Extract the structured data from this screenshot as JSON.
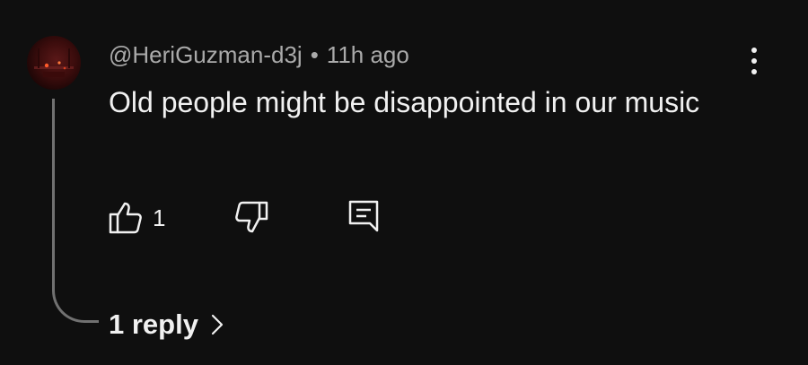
{
  "comment": {
    "author": "@HeriGuzman-d3j",
    "separator": "•",
    "timestamp": "11h ago",
    "text": "Old people might be disappointed in our music",
    "like_count": "1"
  },
  "replies": {
    "label": "1 reply"
  },
  "icons": {
    "avatar": "avatar-image",
    "more": "more-vertical-icon",
    "like": "thumbs-up-icon",
    "dislike": "thumbs-down-icon",
    "reply": "comment-reply-icon",
    "expand": "chevron-right-icon"
  },
  "colors": {
    "background": "#0f0f0f",
    "primary_text": "#f1f1f1",
    "secondary_text": "#aaaaaa",
    "thread_line": "#717171"
  }
}
